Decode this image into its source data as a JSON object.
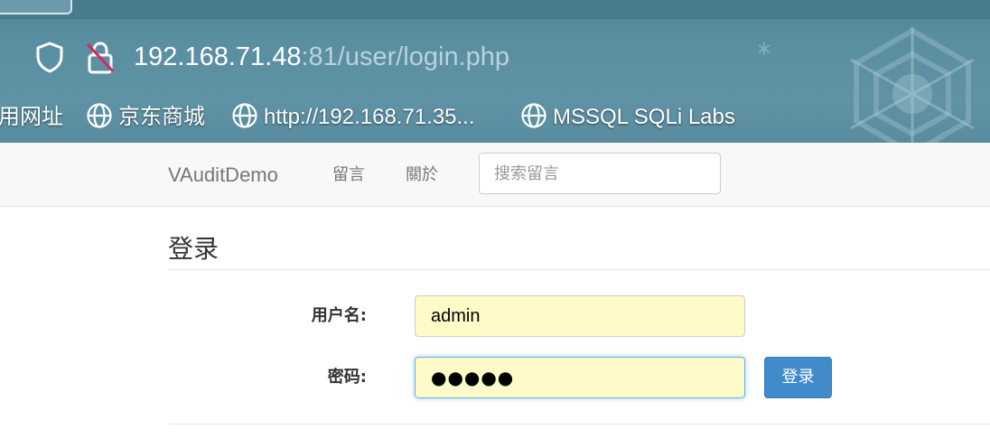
{
  "browser": {
    "url_host": "192.168.71.48",
    "url_rest": ":81/user/login.php",
    "bookmarks": [
      {
        "label": "用网址",
        "icon": "none"
      },
      {
        "label": "京东商城",
        "icon": "globe-icon"
      },
      {
        "label": "http://192.168.71.35...",
        "icon": "globe-icon"
      },
      {
        "label": "MSSQL SQLi Labs",
        "icon": "globe-icon"
      }
    ],
    "colors": {
      "chrome": "#5a8ea1",
      "url_host": "#ffffff",
      "url_rest": "#b9d3dc"
    }
  },
  "navbar": {
    "brand": "VAuditDemo",
    "links": [
      "留言",
      "關於"
    ],
    "search_placeholder": "搜索留言"
  },
  "login": {
    "title": "登录",
    "username_label": "用户名:",
    "username_value": "admin",
    "password_label": "密码:",
    "password_masked": "●●●●●",
    "submit_label": "登录",
    "colors": {
      "field_bg": "#fffbc8",
      "button": "#428bca"
    }
  }
}
